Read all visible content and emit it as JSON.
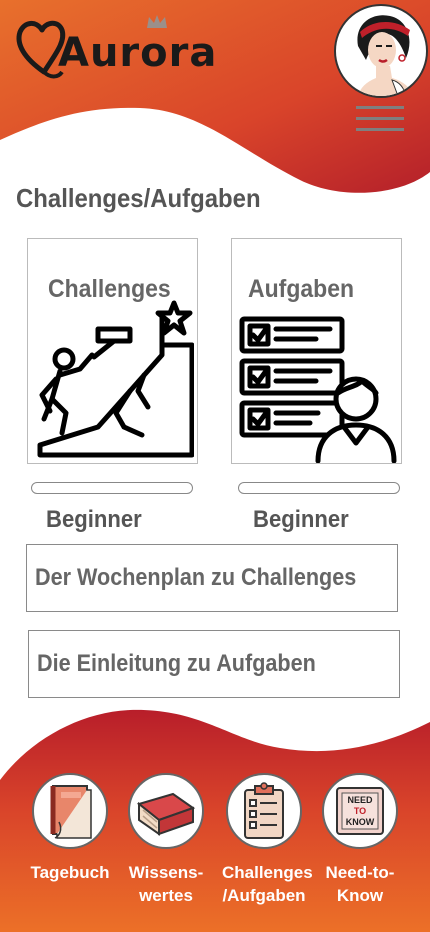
{
  "app": {
    "name": "Aurora"
  },
  "header": {
    "menu_icon": "hamburger-menu-icon"
  },
  "page": {
    "title": "Challenges/Aufgaben"
  },
  "cards": [
    {
      "title": "Challenges",
      "icon": "climbing-to-goal-icon",
      "level": "Beginner",
      "progress": 0
    },
    {
      "title": "Aufgaben",
      "icon": "task-checklist-icon",
      "level": "Beginner",
      "progress": 0
    }
  ],
  "buttons": {
    "weekly_plan": "Der Wochenplan zu Challenges",
    "intro": "Die Einleitung zu Aufgaben"
  },
  "nav": [
    {
      "label": "Tagebuch",
      "icon": "diary-book-icon"
    },
    {
      "label": "Wissens-\nwertes",
      "icon": "books-icon"
    },
    {
      "label": "Challenges\n/Aufgaben",
      "icon": "clipboard-icon"
    },
    {
      "label": "Need-to-\nKnow",
      "icon": "need-to-know-sign-icon"
    }
  ],
  "colors": {
    "accent_dark": "#b5202a",
    "accent_orange": "#e86a2a",
    "text_gray": "#555555"
  }
}
